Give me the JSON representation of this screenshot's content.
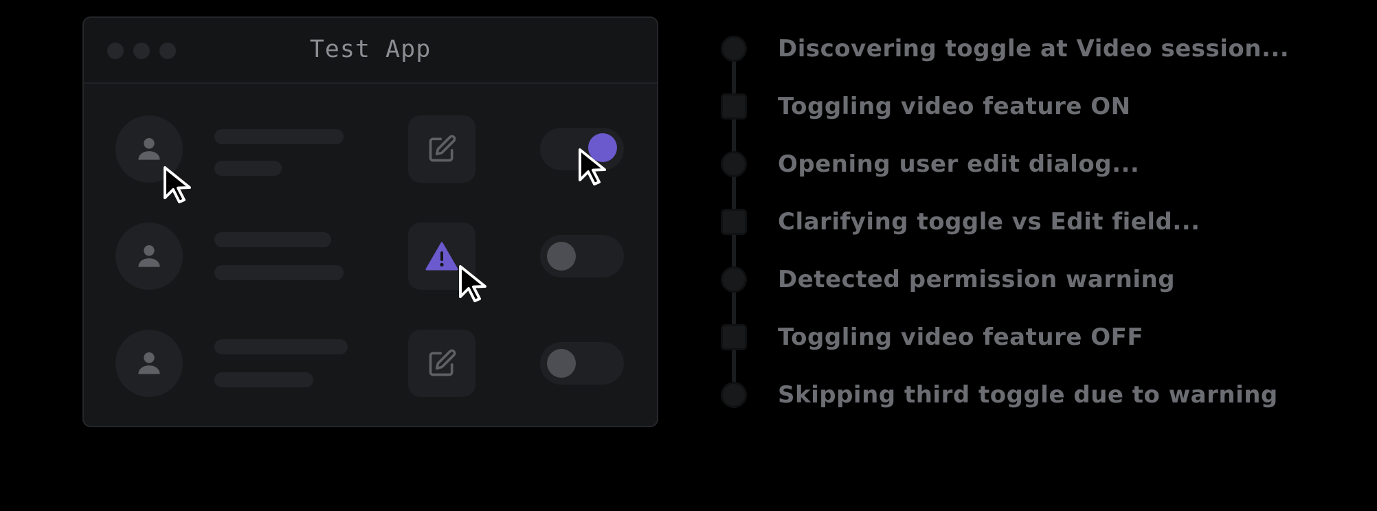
{
  "window": {
    "title": "Test App"
  },
  "rows": [
    {
      "action_icon": "edit-icon",
      "toggle_state": "on"
    },
    {
      "action_icon": "warning-icon",
      "toggle_state": "off"
    },
    {
      "action_icon": "edit-icon",
      "toggle_state": "off"
    }
  ],
  "timeline": {
    "steps": [
      {
        "label": "Discovering toggle at Video session...",
        "shape": "circle"
      },
      {
        "label": "Toggling video feature ON",
        "shape": "square"
      },
      {
        "label": "Opening user edit dialog...",
        "shape": "circle"
      },
      {
        "label": "Clarifying toggle vs Edit field...",
        "shape": "square"
      },
      {
        "label": "Detected permission warning",
        "shape": "circle"
      },
      {
        "label": "Toggling video feature OFF",
        "shape": "square"
      },
      {
        "label": "Skipping third toggle due to warning",
        "shape": "circle"
      }
    ]
  },
  "colors": {
    "accent": "#6a5acd",
    "background": "#000000",
    "window_bg": "#161719",
    "muted_text": "#6b6d72"
  }
}
